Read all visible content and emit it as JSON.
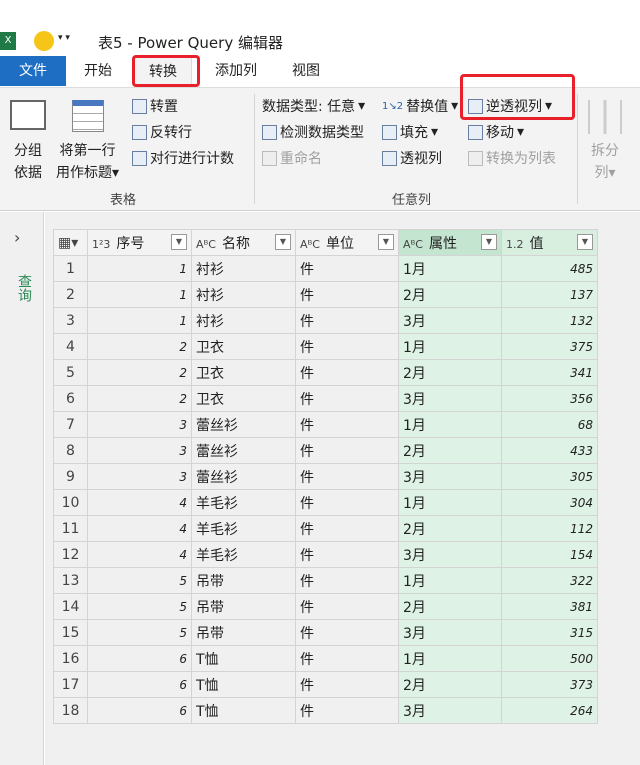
{
  "window": {
    "title": "表5 - Power Query 编辑器"
  },
  "tabs": [
    {
      "label": "文件"
    },
    {
      "label": "开始"
    },
    {
      "label": "转换"
    },
    {
      "label": "添加列"
    },
    {
      "label": "视图"
    }
  ],
  "ribbon": {
    "group_table": {
      "label": "表格",
      "group_by_1": "分组",
      "group_by_2": "依据",
      "first_row_1": "将第一行",
      "first_row_2": "用作标题",
      "transpose": "转置",
      "reverse_rows": "反转行",
      "count_rows": "对行进行计数"
    },
    "group_any": {
      "label": "任意列",
      "data_type": "数据类型: 任意",
      "detect_type": "检测数据类型",
      "rename": "重命名",
      "replace": "替换值",
      "fill": "填充",
      "pivot": "透视列",
      "unpivot": "逆透视列",
      "move": "移动",
      "to_list": "转换为列表"
    },
    "split_1": "拆分",
    "split_2": "列"
  },
  "sidebar": {
    "label": "查询"
  },
  "table": {
    "headers": [
      {
        "type": "1²3",
        "label": "序号"
      },
      {
        "type": "AᴮC",
        "label": "名称"
      },
      {
        "type": "AᴮC",
        "label": "单位"
      },
      {
        "type": "AᴮC",
        "label": "属性"
      },
      {
        "type": "1.2",
        "label": "值"
      }
    ],
    "rows": [
      [
        "1",
        "衬衫",
        "件",
        "1月",
        "485"
      ],
      [
        "1",
        "衬衫",
        "件",
        "2月",
        "137"
      ],
      [
        "1",
        "衬衫",
        "件",
        "3月",
        "132"
      ],
      [
        "2",
        "卫衣",
        "件",
        "1月",
        "375"
      ],
      [
        "2",
        "卫衣",
        "件",
        "2月",
        "341"
      ],
      [
        "2",
        "卫衣",
        "件",
        "3月",
        "356"
      ],
      [
        "3",
        "蕾丝衫",
        "件",
        "1月",
        "68"
      ],
      [
        "3",
        "蕾丝衫",
        "件",
        "2月",
        "433"
      ],
      [
        "3",
        "蕾丝衫",
        "件",
        "3月",
        "305"
      ],
      [
        "4",
        "羊毛衫",
        "件",
        "1月",
        "304"
      ],
      [
        "4",
        "羊毛衫",
        "件",
        "2月",
        "112"
      ],
      [
        "4",
        "羊毛衫",
        "件",
        "3月",
        "154"
      ],
      [
        "5",
        "吊带",
        "件",
        "1月",
        "322"
      ],
      [
        "5",
        "吊带",
        "件",
        "2月",
        "381"
      ],
      [
        "5",
        "吊带",
        "件",
        "3月",
        "315"
      ],
      [
        "6",
        "T恤",
        "件",
        "1月",
        "500"
      ],
      [
        "6",
        "T恤",
        "件",
        "2月",
        "373"
      ],
      [
        "6",
        "T恤",
        "件",
        "3月",
        "264"
      ]
    ]
  },
  "colors": {
    "file_tab": "#1e6fc4",
    "highlight": "#e8202a",
    "selected_col": "#dff2e6"
  }
}
